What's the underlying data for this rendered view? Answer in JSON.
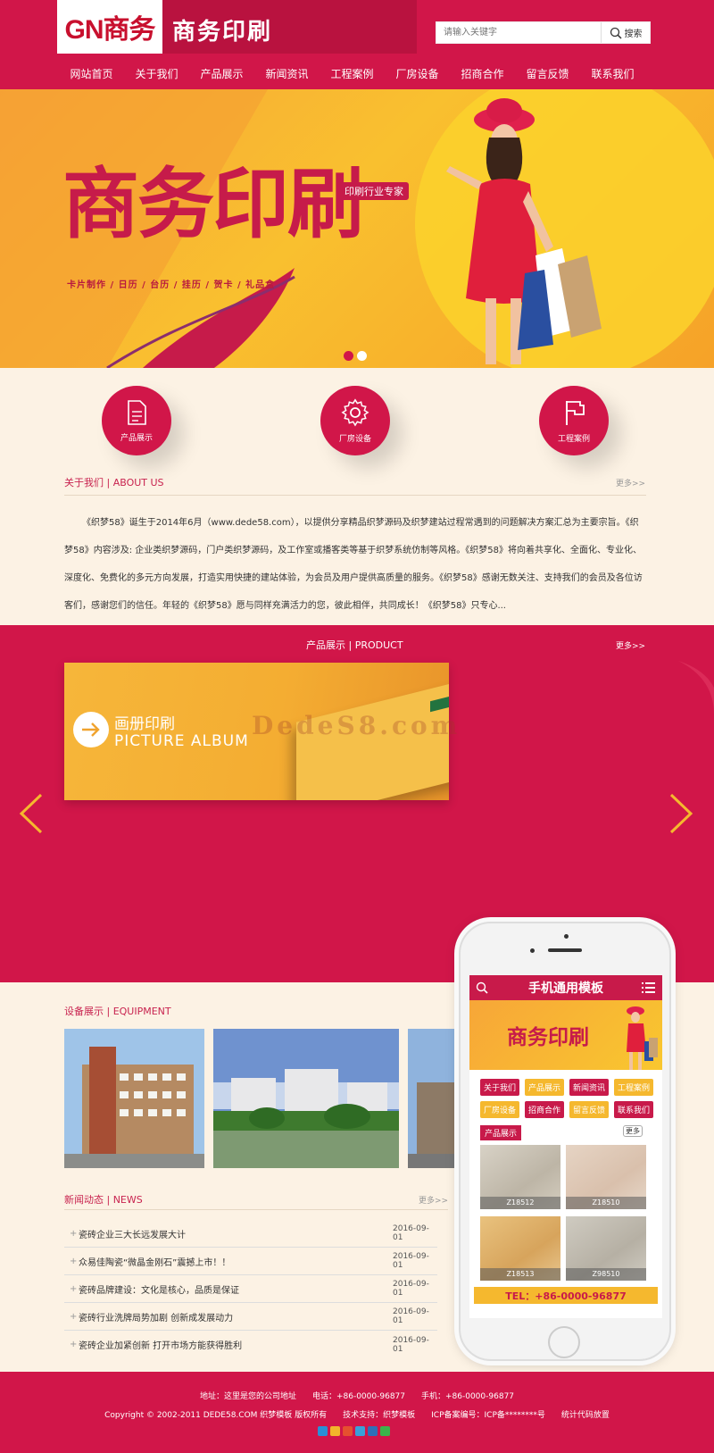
{
  "header": {
    "logo_text": "GN商务",
    "brand_title": "商务印刷",
    "search_placeholder": "请输入关键字",
    "search_button": "搜索"
  },
  "nav": {
    "items": [
      "网站首页",
      "关于我们",
      "产品展示",
      "新闻资讯",
      "工程案例",
      "厂房设备",
      "招商合作",
      "留言反馈",
      "联系我们"
    ]
  },
  "banner": {
    "title": "商务印刷",
    "tag": "印刷行业专家",
    "subtitle": "卡片制作  /  日历  /  台历  /  挂历  /  贺卡  /  礼品盒",
    "active_slide": 1,
    "slide_count": 2
  },
  "features": [
    {
      "label": "产品展示",
      "icon": "document-icon"
    },
    {
      "label": "厂房设备",
      "icon": "gear-icon"
    },
    {
      "label": "工程案例",
      "icon": "flag-icon"
    }
  ],
  "about": {
    "title": "关于我们 | ABOUT US",
    "more": "更多>>",
    "text": "《织梦58》诞生于2014年6月（www.dede58.com），以提供分享精品织梦源码及织梦建站过程常遇到的问题解决方案汇总为主要宗旨。《织梦58》内容涉及: 企业类织梦源码，门户类织梦源码，及工作室或播客类等基于织梦系统仿制等风格。《织梦58》将向着共享化、全面化、专业化、深度化、免费化的多元方向发展，打造实用快捷的建站体验，为会员及用户提供高质量的服务。《织梦58》感谢无数关注、支持我们的会员及各位访客们，感谢您们的信任。年轻的《织梦58》愿与同样充满活力的您，彼此相伴，共同成长！《织梦58》只专心..."
  },
  "product": {
    "title": "产品展示 | PRODUCT",
    "more": "更多>>",
    "card_title": "画册印刷",
    "card_subtitle": "PICTURE ALBUM",
    "watermark": "DedeS8.com"
  },
  "equipment": {
    "title": "设备展示 | EQUIPMENT"
  },
  "news": {
    "title": "新闻动态 | NEWS",
    "more": "更多>>",
    "items": [
      {
        "title": "瓷砖企业三大长远发展大计",
        "date": "2016-09-01"
      },
      {
        "title": "众易佳陶瓷“微晶金刚石”震撼上市！！",
        "date": "2016-09-01"
      },
      {
        "title": "瓷砖品牌建设：文化是核心，品质是保证",
        "date": "2016-09-01"
      },
      {
        "title": "瓷砖行业洗牌局势加剧 创新成发展动力",
        "date": "2016-09-01"
      },
      {
        "title": "瓷砖企业加紧创新 打开市场方能获得胜利",
        "date": "2016-09-01"
      }
    ]
  },
  "phone": {
    "header_title": "手机通用模板",
    "banner_title": "商务印刷",
    "nav": [
      {
        "label": "关于我们",
        "color": "#c81a4a"
      },
      {
        "label": "产品展示",
        "color": "#f5b82e"
      },
      {
        "label": "新闻资讯",
        "color": "#c81a4a"
      },
      {
        "label": "工程案例",
        "color": "#f5b82e"
      },
      {
        "label": "厂房设备",
        "color": "#f5b82e"
      },
      {
        "label": "招商合作",
        "color": "#c81a4a"
      },
      {
        "label": "留言反馈",
        "color": "#f5b82e"
      },
      {
        "label": "联系我们",
        "color": "#c81a4a"
      }
    ],
    "section_label": "产品展示",
    "more": "更多",
    "tiles": [
      "Z18512",
      "Z18510",
      "Z18513",
      "Z98510"
    ],
    "tel": "TEL：+86-0000-96877"
  },
  "footer": {
    "line1": "地址：这里是您的公司地址　　电话：+86-0000-96877　　手机：+86-0000-96877",
    "line2": "Copyright © 2002-2011 DEDE58.COM 织梦模板 版权所有　　技术支持：织梦模板　　ICP备案编号：ICP备********号　　统计代码放置"
  },
  "colors": {
    "primary": "#d11649",
    "accent": "#f5b82e",
    "cream": "#fcf2e4"
  }
}
